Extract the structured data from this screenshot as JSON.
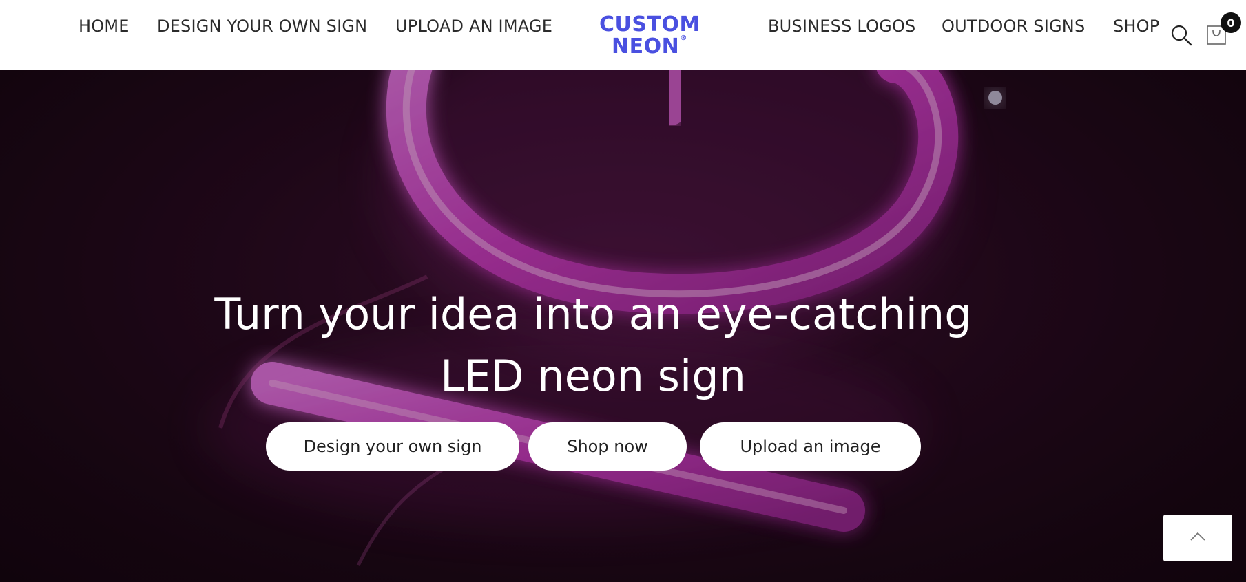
{
  "nav": {
    "left": [
      {
        "label": "HOME"
      },
      {
        "label": "DESIGN YOUR OWN SIGN"
      },
      {
        "label": "UPLOAD AN IMAGE"
      }
    ],
    "right": [
      {
        "label": "BUSINESS LOGOS"
      },
      {
        "label": "OUTDOOR SIGNS"
      },
      {
        "label": "SHOP"
      }
    ]
  },
  "logo": {
    "line1": "CUSTOM",
    "line2": "NEON",
    "reg": "®",
    "color": "#4a50e0"
  },
  "icons": {
    "search": "search-icon",
    "cart": "cart-icon",
    "back_to_top": "chevron-up-icon"
  },
  "cart": {
    "count": "0"
  },
  "hero": {
    "title_line1": "Turn your idea into an eye-catching",
    "title_line2": "LED neon sign",
    "buttons": {
      "design": "Design your own sign",
      "shop": "Shop now",
      "upload": "Upload an image"
    },
    "neon_color": "#e04ad6"
  }
}
